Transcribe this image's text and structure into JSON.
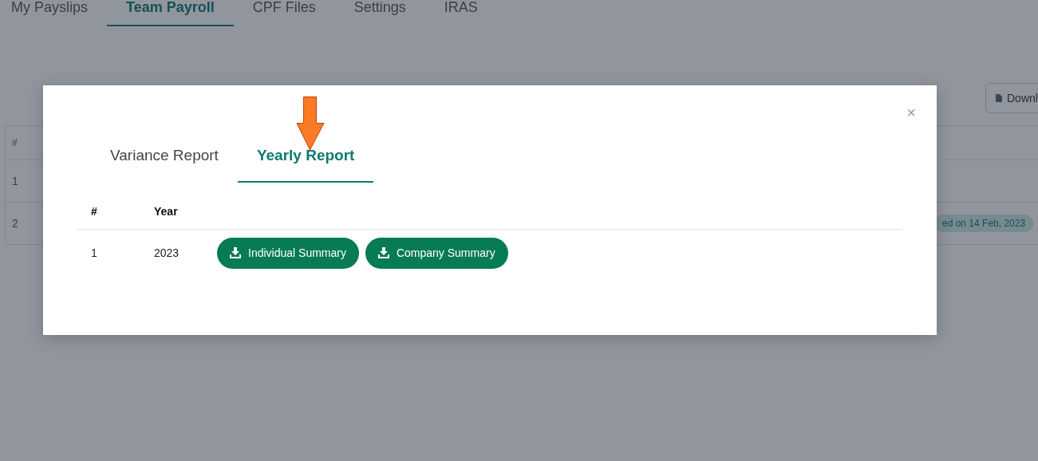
{
  "nav_tabs": [
    {
      "label": "My Payslips",
      "selected": false
    },
    {
      "label": "Team Payroll",
      "selected": true
    },
    {
      "label": "CPF Files",
      "selected": false
    },
    {
      "label": "Settings",
      "selected": false
    },
    {
      "label": "IRAS",
      "selected": false
    }
  ],
  "download_button": "Downl",
  "background_table": {
    "header": "#",
    "rows": [
      {
        "index": "1"
      },
      {
        "index": "2",
        "badge": "ed on 14 Feb, 2023"
      }
    ]
  },
  "modal": {
    "close": "×",
    "tabs": [
      {
        "label": "Variance Report",
        "selected": false
      },
      {
        "label": "Yearly Report",
        "selected": true
      }
    ],
    "columns": [
      "#",
      "Year"
    ],
    "rows": [
      {
        "index": "1",
        "year": "2023",
        "actions": [
          "Individual Summary",
          "Company Summary"
        ]
      }
    ]
  }
}
